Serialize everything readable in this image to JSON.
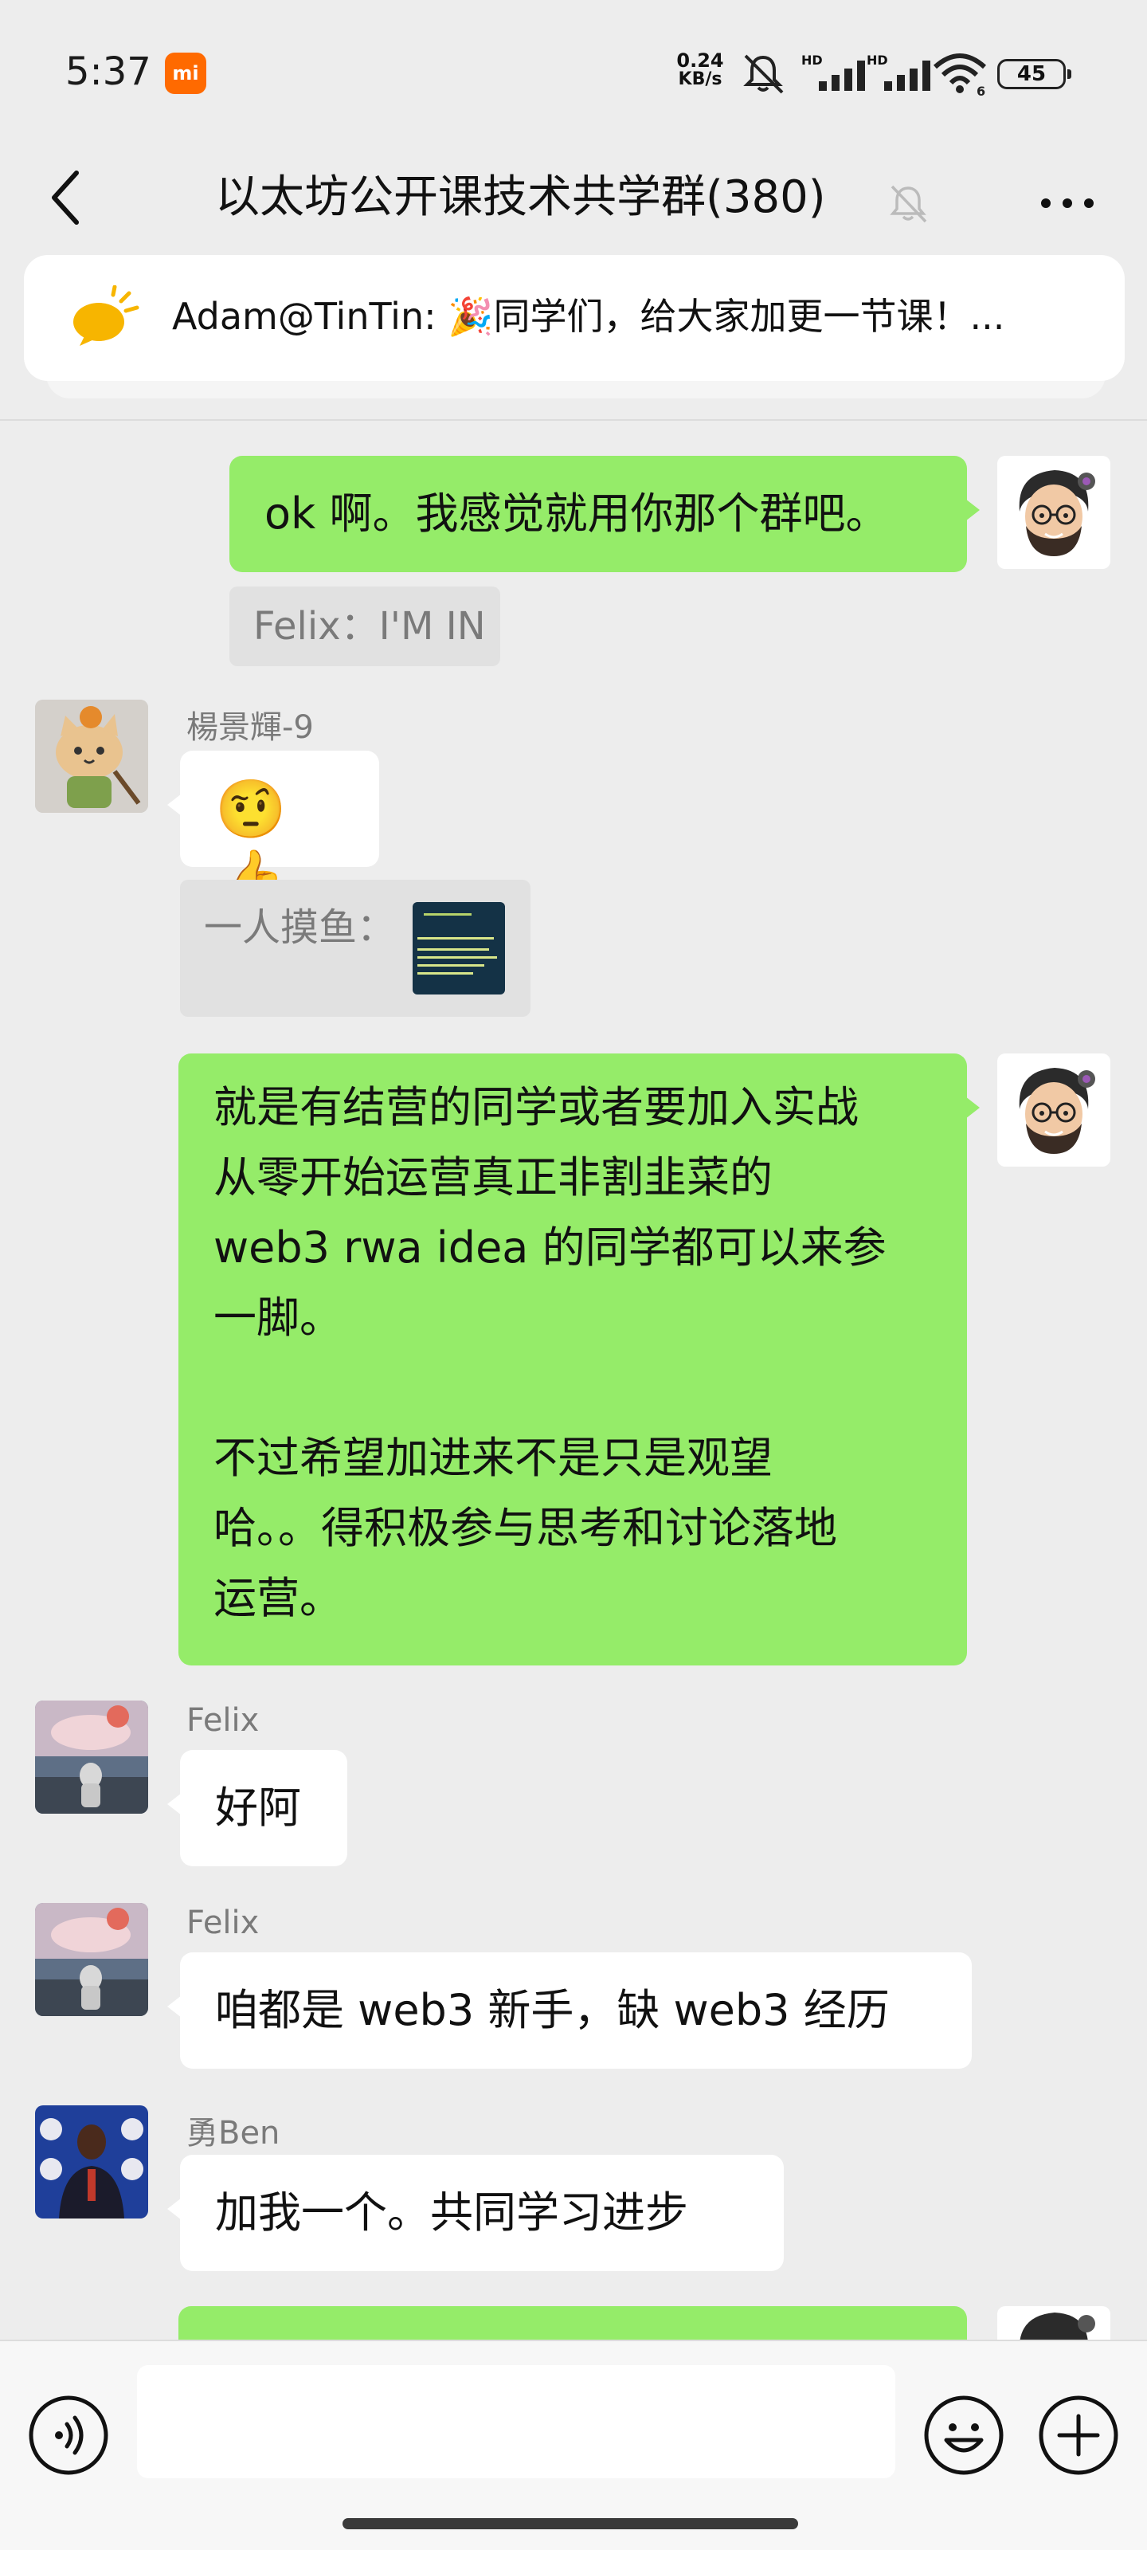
{
  "status_bar": {
    "time": "5:37",
    "mi_badge": "mi",
    "net_speed_value": "0.24",
    "net_speed_unit": "KB/s",
    "signal1_label": "HD",
    "signal2_label": "HD",
    "wifi_sub": "6",
    "battery": "45"
  },
  "header": {
    "title": "以太坊公开课技术共学群(380)",
    "back_icon": "chevron-left-icon",
    "mute_icon": "bell-off-icon",
    "more_icon": "more-dots-icon"
  },
  "announcement": {
    "icon": "megaphone-icon",
    "text": "Adam@TinTin: 🎉同学们，给大家加更一节课！..."
  },
  "messages": [
    {
      "side": "right",
      "text": "ok 啊。我感觉就用你那个群吧。"
    },
    {
      "side": "right-quote",
      "text": "Felix：I'M IN"
    },
    {
      "side": "left",
      "sender": "楊景輝-9",
      "text": "🤨👍"
    },
    {
      "side": "left-quote",
      "text": "一人摸鱼："
    },
    {
      "side": "right",
      "text": "就是有结营的同学或者要加入实战\n从零开始运营真正非割韭菜的\nweb3 rwa idea 的同学都可以来参\n一脚。\n\n不过希望加进来不是只是观望\n哈。。得积极参与思考和讨论落地\n运营。"
    },
    {
      "side": "left",
      "sender": "Felix",
      "text": "好阿"
    },
    {
      "side": "left",
      "sender": "Felix",
      "text": "咱都是 web3 新手，缺 web3 经历"
    },
    {
      "side": "left",
      "sender": "勇Ben",
      "text": "加我一个。共同学习进步"
    }
  ],
  "input_bar": {
    "placeholder": "",
    "voice_icon": "voice-icon",
    "emoji_icon": "emoji-icon",
    "plus_icon": "plus-icon"
  },
  "colors": {
    "background": "#ededed",
    "bubble_mine": "#95ec69",
    "bubble_other": "#ffffff",
    "accent_orange": "#ff6a00"
  }
}
